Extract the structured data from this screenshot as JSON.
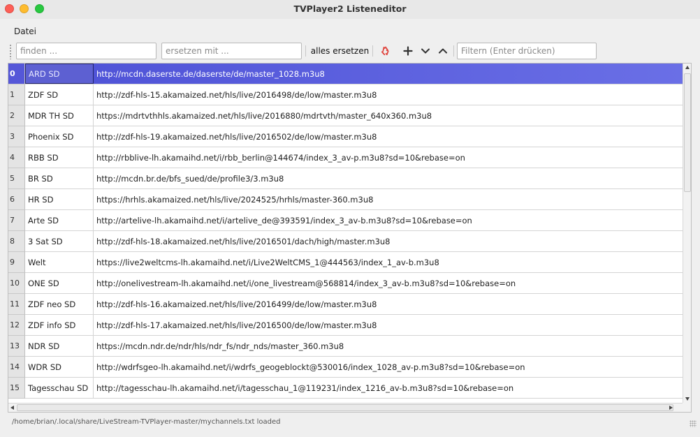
{
  "window": {
    "title": "TVPlayer2 Listeneditor"
  },
  "menu": {
    "items": [
      "Datei"
    ]
  },
  "toolbar": {
    "find_placeholder": "finden ...",
    "replace_placeholder": "ersetzen mit ...",
    "replace_all_label": "alles ersetzen",
    "filter_placeholder": "Filtern (Enter drücken)",
    "icons": {
      "delete": "delete-icon",
      "add": "plus-icon",
      "down": "chevron-down-icon",
      "up": "chevron-up-icon"
    },
    "colors": {
      "delete_icon": "#e0433c"
    }
  },
  "table": {
    "selected_row": 0,
    "rows": [
      {
        "index": "0",
        "name": "ARD SD",
        "url": "http://mcdn.daserste.de/daserste/de/master_1028.m3u8"
      },
      {
        "index": "1",
        "name": "ZDF SD",
        "url": "http://zdf-hls-15.akamaized.net/hls/live/2016498/de/low/master.m3u8"
      },
      {
        "index": "2",
        "name": "MDR TH SD",
        "url": "https://mdrtvthhls.akamaized.net/hls/live/2016880/mdrtvth/master_640x360.m3u8"
      },
      {
        "index": "3",
        "name": "Phoenix SD",
        "url": "http://zdf-hls-19.akamaized.net/hls/live/2016502/de/low/master.m3u8"
      },
      {
        "index": "4",
        "name": "RBB SD",
        "url": "http://rbblive-lh.akamaihd.net/i/rbb_berlin@144674/index_3_av-p.m3u8?sd=10&rebase=on"
      },
      {
        "index": "5",
        "name": "BR SD",
        "url": "http://mcdn.br.de/bfs_sued/de/profile3/3.m3u8"
      },
      {
        "index": "6",
        "name": "HR SD",
        "url": "https://hrhls.akamaized.net/hls/live/2024525/hrhls/master-360.m3u8"
      },
      {
        "index": "7",
        "name": "Arte SD",
        "url": "http://artelive-lh.akamaihd.net/i/artelive_de@393591/index_3_av-b.m3u8?sd=10&rebase=on"
      },
      {
        "index": "8",
        "name": "3 Sat SD",
        "url": "http://zdf-hls-18.akamaized.net/hls/live/2016501/dach/high/master.m3u8"
      },
      {
        "index": "9",
        "name": "Welt",
        "url": "https://live2weltcms-lh.akamaihd.net/i/Live2WeltCMS_1@444563/index_1_av-b.m3u8"
      },
      {
        "index": "10",
        "name": "ONE SD",
        "url": "http://onelivestream-lh.akamaihd.net/i/one_livestream@568814/index_3_av-b.m3u8?sd=10&rebase=on"
      },
      {
        "index": "11",
        "name": "ZDF neo SD",
        "url": "http://zdf-hls-16.akamaized.net/hls/live/2016499/de/low/master.m3u8"
      },
      {
        "index": "12",
        "name": "ZDF info SD",
        "url": "http://zdf-hls-17.akamaized.net/hls/live/2016500/de/low/master.m3u8"
      },
      {
        "index": "13",
        "name": "NDR SD",
        "url": "https://mcdn.ndr.de/ndr/hls/ndr_fs/ndr_nds/master_360.m3u8"
      },
      {
        "index": "14",
        "name": "WDR SD",
        "url": "http://wdrfsgeo-lh.akamaihd.net/i/wdrfs_geogeblockt@530016/index_1028_av-p.m3u8?sd=10&rebase=on"
      },
      {
        "index": "15",
        "name": "Tagesschau SD",
        "url": "http://tagesschau-lh.akamaihd.net/i/tagesschau_1@119231/index_1216_av-b.m3u8?sd=10&rebase=on"
      }
    ]
  },
  "status": {
    "text": "/home/brian/.local/share/LiveStream-TVPlayer-master/mychannels.txt loaded"
  },
  "colors": {
    "selection": "#5557d8",
    "selection_end": "#6a6fe6"
  }
}
